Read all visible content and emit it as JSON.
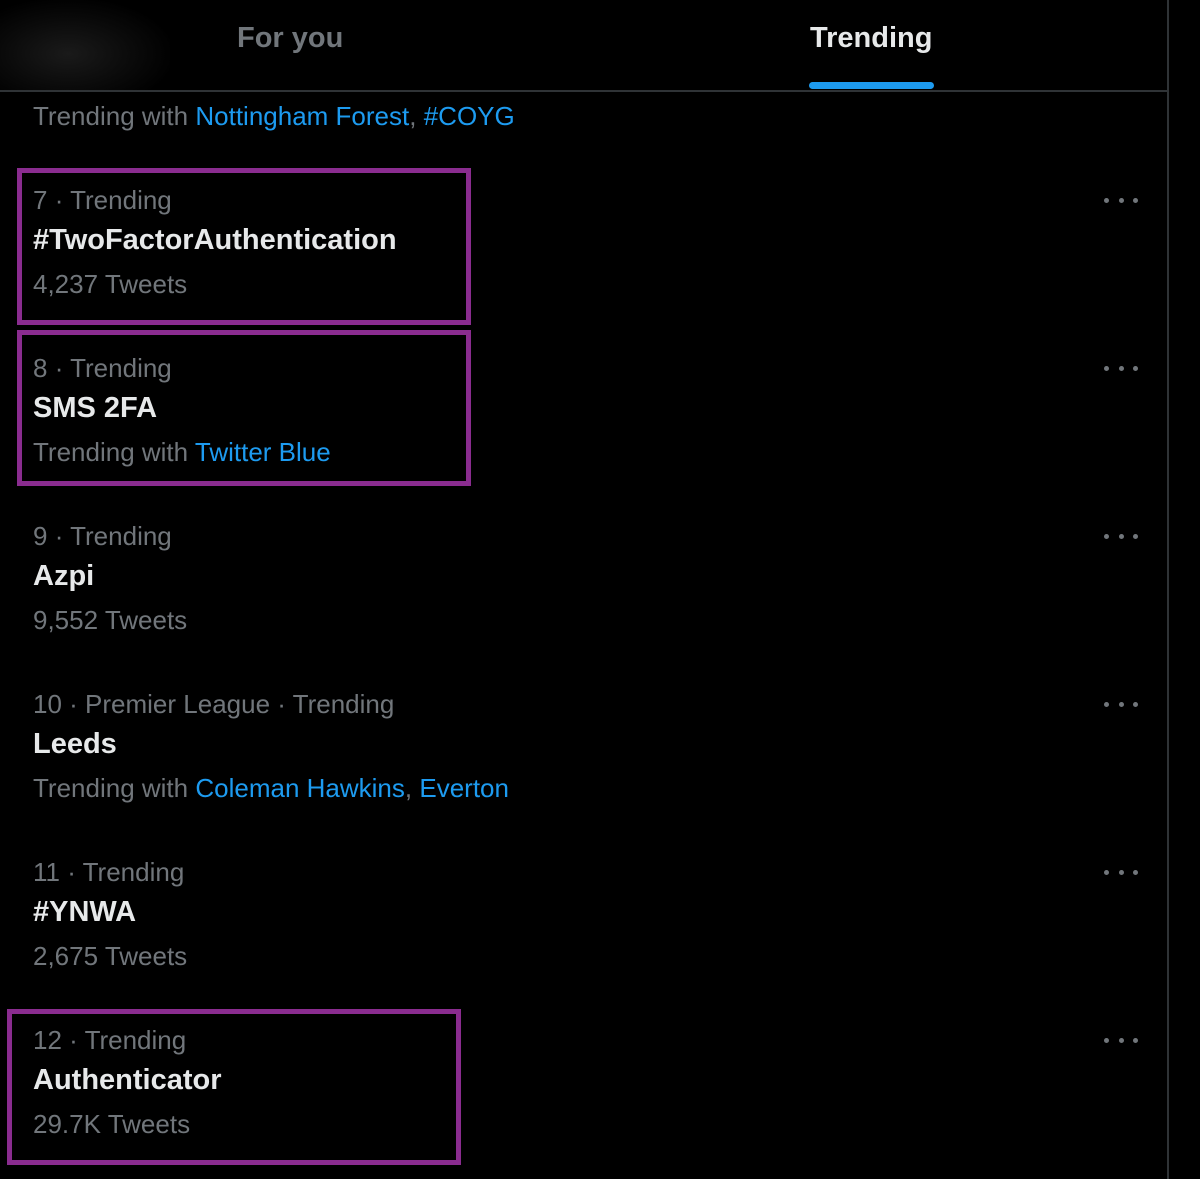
{
  "tabs": {
    "for_you": "For you",
    "trending": "Trending",
    "active": "trending"
  },
  "top_row": {
    "prefix": "Trending with",
    "links": [
      "Nottingham Forest",
      "#COYG"
    ]
  },
  "trends": [
    {
      "rank": "7",
      "context": "Trending",
      "name": "#TwoFactorAuthentication",
      "count": "4,237 Tweets",
      "highlighted": true
    },
    {
      "rank": "8",
      "context": "Trending",
      "name": "SMS 2FA",
      "trending_with": {
        "prefix": "Trending with",
        "links": [
          "Twitter Blue"
        ]
      },
      "highlighted": true
    },
    {
      "rank": "9",
      "context": "Trending",
      "name": "Azpi",
      "count": "9,552 Tweets",
      "highlighted": false
    },
    {
      "rank": "10",
      "context": "Premier League · Trending",
      "name": "Leeds",
      "trending_with": {
        "prefix": "Trending with",
        "links": [
          "Coleman Hawkins",
          "Everton"
        ]
      },
      "highlighted": false
    },
    {
      "rank": "11",
      "context": "Trending",
      "name": "#YNWA",
      "count": "2,675 Tweets",
      "highlighted": false
    },
    {
      "rank": "12",
      "context": "Trending",
      "name": "Authenticator",
      "count": "29.7K Tweets",
      "highlighted": true
    }
  ],
  "icons": {
    "more": "more-horizontal-icon"
  },
  "colors": {
    "background": "#000000",
    "text_primary": "#e7e9ea",
    "text_secondary": "#71767b",
    "accent": "#1d9bf0",
    "highlight_box": "#8a2c8f",
    "divider": "#2f3336"
  }
}
